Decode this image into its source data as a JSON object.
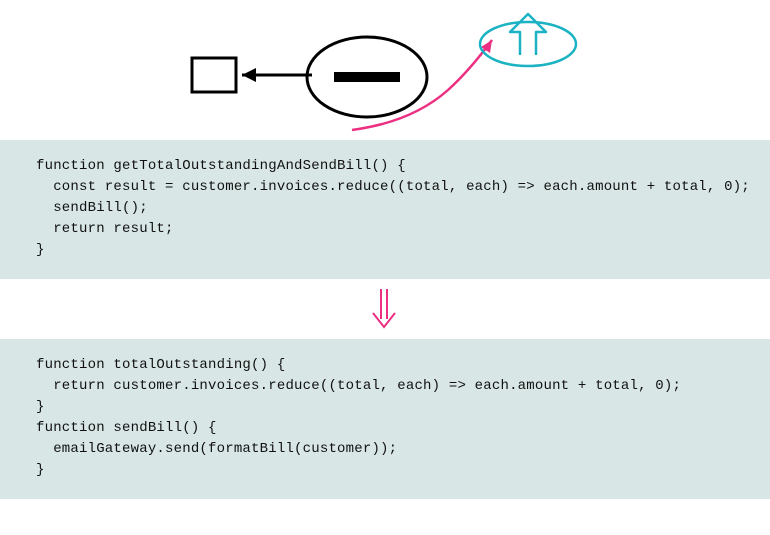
{
  "diagram": {
    "description": "Separate query from modifier refactoring illustration",
    "elements": {
      "square_box": "rectangle-box",
      "oval_with_bar": "oval-function",
      "dashed_oval_with_arrow": "dashed-oval-revert",
      "left_arrow": "arrow-left",
      "curved_pink_arrow": "pink-curved-arrow"
    },
    "colors": {
      "black": "#000000",
      "teal": "#1bb3c4",
      "pink": "#ec2f82"
    }
  },
  "code_before": "function getTotalOutstandingAndSendBill() {\n  const result = customer.invoices.reduce((total, each) => each.amount + total, 0);\n  sendBill();\n  return result;\n}",
  "code_after": "function totalOutstanding() {\n  return customer.invoices.reduce((total, each) => each.amount + total, 0);\n}\nfunction sendBill() {\n  emailGateway.send(formatBill(customer));\n}",
  "transition_arrow": "down-double-arrow"
}
